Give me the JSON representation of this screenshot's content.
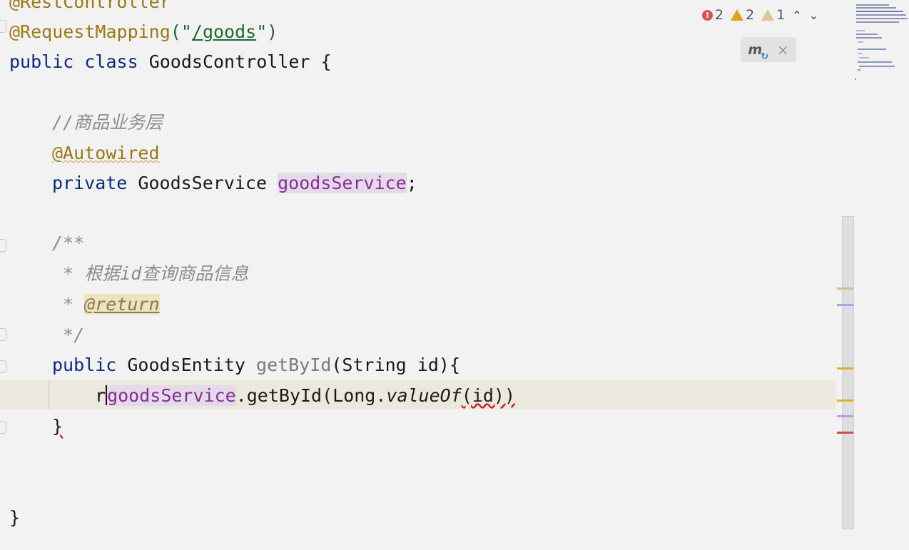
{
  "code": {
    "l0": "@RestController",
    "l1_ann": "@RequestMapping",
    "l1_open": "(\"",
    "l1_url": "/goods",
    "l1_close": "\")",
    "l2_kw1": "public",
    "l2_kw2": "class",
    "l2_name": "GoodsController {",
    "l4_comment": "//商品业务层",
    "l5_ann": "@Autowired",
    "l6_kw": "private",
    "l6_type": "GoodsService",
    "l6_field": "goodsService",
    "l6_end": ";",
    "l8": "/**",
    "l9": " * 根据id查询商品信息",
    "l10_star": " * ",
    "l10_tag": "@return",
    "l11": " */",
    "l12_kw": "public",
    "l12_type": "GoodsEntity",
    "l12_method": "getById",
    "l12_params": "(String id){",
    "l13_r": "r",
    "l13_field": "goodsService",
    "l13_call": ".getById(Long.",
    "l13_valueof": "valueOf",
    "l13_end": "(id))",
    "l14": "}",
    "l17": "}"
  },
  "inspections": {
    "errors": "2",
    "warnings": "2",
    "weak_warnings": "1",
    "prev_icon": "chevron-up-icon",
    "next_icon": "chevron-down-icon"
  },
  "maven_popup": {
    "icon": "maven-reload-icon",
    "close": "×"
  },
  "colors": {
    "error": "#d9534f",
    "warning": "#e0a21a",
    "keyword": "#0b2b7d",
    "annotation": "#9a7a14",
    "field": "#8a2c98"
  }
}
